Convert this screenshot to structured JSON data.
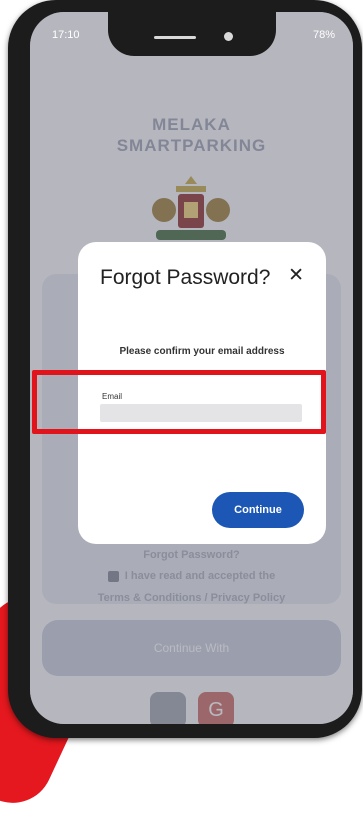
{
  "status_bar": {
    "time": "17:10",
    "right": "78%"
  },
  "app": {
    "title_line1": "MELAKA",
    "title_line2": "SMARTPARKING"
  },
  "background": {
    "forgot_password_link": "Forgot Password?",
    "terms_text": "I have read and accepted the",
    "terms_links": "Terms & Conditions / Privacy Policy",
    "continue_with": "Continue With",
    "social_google": "G"
  },
  "modal": {
    "title": "Forgot Password?",
    "close_symbol": "✕",
    "message": "Please confirm your email address",
    "email_label": "Email",
    "email_value": "",
    "continue_label": "Continue"
  },
  "colors": {
    "accent": "#1d57b5",
    "highlight": "#e0141a",
    "brand_red": "#e4181e"
  }
}
